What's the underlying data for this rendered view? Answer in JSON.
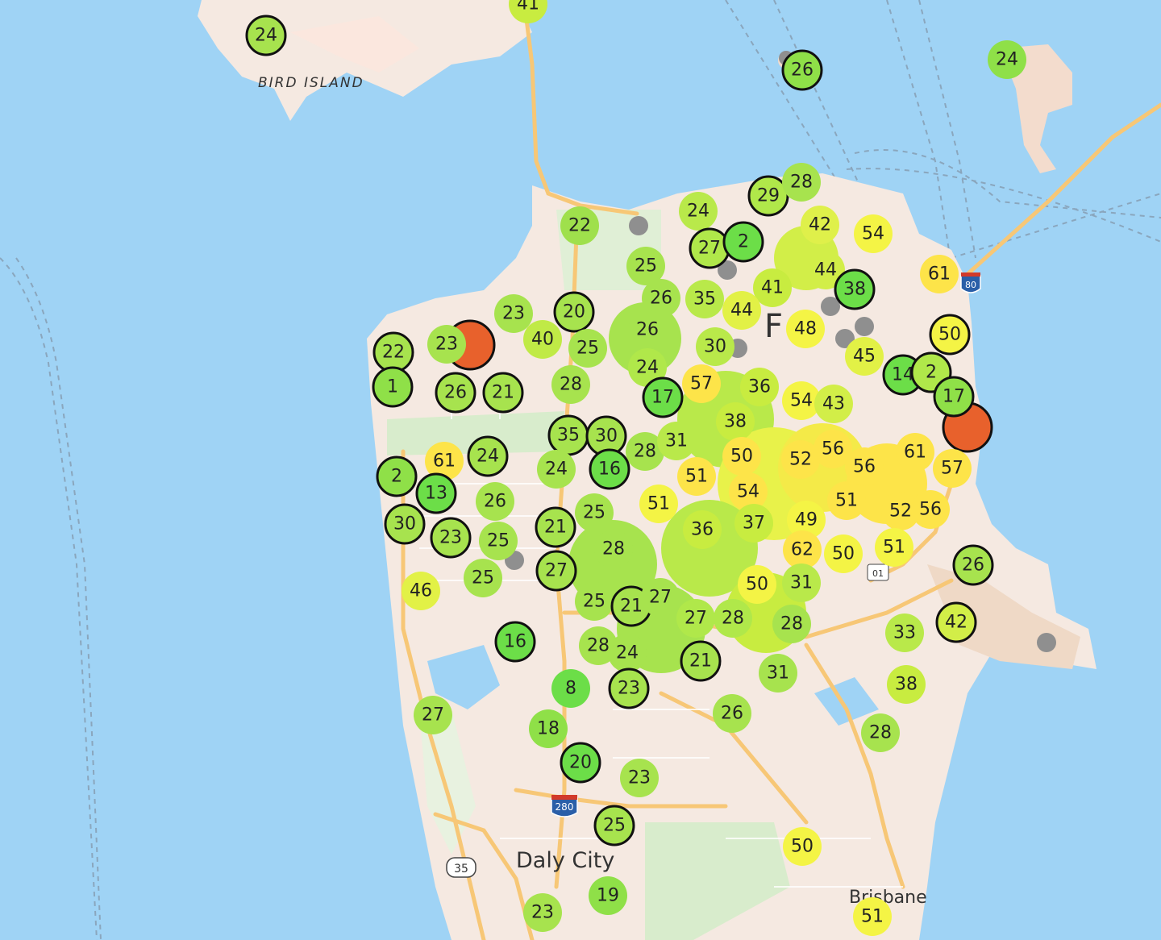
{
  "map": {
    "place_labels": {
      "bird_island": "BIRD ISLAND",
      "daly_city": "Daly City",
      "brisbane": "Brisbane",
      "sf_partial": "F"
    },
    "shields": {
      "i280": "280",
      "ca35": "35",
      "i80": "80",
      "i101": "01"
    },
    "colors": {
      "water": "#9fd3f5",
      "land": "#f5e9e1",
      "park": "#d8eccc",
      "road": "#f7c776",
      "gray_marker": "#8f8f8f",
      "ring": "#111111"
    }
  },
  "markers": [
    {
      "value": "41",
      "color": "#c8ec40",
      "ring": false
    },
    {
      "value": "24",
      "color": "#a7e34e",
      "ring": true
    },
    {
      "value": "26",
      "color": "#8fe048",
      "ring": true
    },
    {
      "value": "24",
      "color": "#8fe048",
      "ring": false
    },
    {
      "value": "29",
      "color": "#b0e84a",
      "ring": true
    },
    {
      "value": "28",
      "color": "#a7e34e",
      "ring": false
    },
    {
      "value": "22",
      "color": "#9fe04c",
      "ring": false
    },
    {
      "value": "24",
      "color": "#b9e94a",
      "ring": false
    },
    {
      "value": "42",
      "color": "#dff04a",
      "ring": false
    },
    {
      "value": "54",
      "color": "#f4f445",
      "ring": false
    },
    {
      "value": "27",
      "color": "#b0e84a",
      "ring": true
    },
    {
      "value": "2",
      "color": "#6cde48",
      "ring": true
    },
    {
      "value": "25",
      "color": "#a7e34e",
      "ring": false
    },
    {
      "value": "44",
      "color": "#d2ee48",
      "ring": false
    },
    {
      "value": "61",
      "color": "#fde449",
      "ring": false
    },
    {
      "value": "38",
      "color": "#6cde48",
      "ring": true
    },
    {
      "value": "41",
      "color": "#c8ec40",
      "ring": false
    },
    {
      "value": "26",
      "color": "#a7e34e",
      "ring": false
    },
    {
      "value": "35",
      "color": "#b9e94a",
      "ring": false
    },
    {
      "value": "44",
      "color": "#e2f146",
      "ring": false
    },
    {
      "value": "20",
      "color": "#a7e34e",
      "ring": true
    },
    {
      "value": "23",
      "color": "#a7e34e",
      "ring": false
    },
    {
      "value": "40",
      "color": "#c0ea46",
      "ring": false
    },
    {
      "value": "26",
      "color": "#a7e34e",
      "ring": false
    },
    {
      "value": "48",
      "color": "#f4f445",
      "ring": false
    },
    {
      "value": "50",
      "color": "#f4f445",
      "ring": true
    },
    {
      "value": "22",
      "color": "#a7e34e",
      "ring": true
    },
    {
      "value": "23",
      "color": "#a7e34e",
      "ring": false
    },
    {
      "value": "25",
      "color": "#a7e34e",
      "ring": false
    },
    {
      "value": "30",
      "color": "#b9e94a",
      "ring": false
    },
    {
      "value": "45",
      "color": "#e2f146",
      "ring": false
    },
    {
      "value": "1",
      "color": "#8fe048",
      "ring": true
    },
    {
      "value": "26",
      "color": "#a7e34e",
      "ring": true
    },
    {
      "value": "21",
      "color": "#a7e34e",
      "ring": true
    },
    {
      "value": "28",
      "color": "#a7e34e",
      "ring": false
    },
    {
      "value": "24",
      "color": "#b0e84a",
      "ring": false
    },
    {
      "value": "57",
      "color": "#fde449",
      "ring": false
    },
    {
      "value": "36",
      "color": "#c8ec40",
      "ring": false
    },
    {
      "value": "14",
      "color": "#6cde48",
      "ring": true
    },
    {
      "value": "2",
      "color": "#b0e84a",
      "ring": true
    },
    {
      "value": "17",
      "color": "#8fe048",
      "ring": true
    },
    {
      "value": "17",
      "color": "#6cde48",
      "ring": true
    },
    {
      "value": "54",
      "color": "#f4f445",
      "ring": false
    },
    {
      "value": "43",
      "color": "#d2ee48",
      "ring": false
    },
    {
      "value": "38",
      "color": "#c8ec40",
      "ring": false
    },
    {
      "value": "35",
      "color": "#a7e34e",
      "ring": true
    },
    {
      "value": "30",
      "color": "#a7e34e",
      "ring": true
    },
    {
      "value": "28",
      "color": "#a7e34e",
      "ring": false
    },
    {
      "value": "31",
      "color": "#b9e94a",
      "ring": false
    },
    {
      "value": "56",
      "color": "#fde449",
      "ring": false
    },
    {
      "value": "61",
      "color": "#fde449",
      "ring": false
    },
    {
      "value": "61",
      "color": "#fde449",
      "ring": false
    },
    {
      "value": "24",
      "color": "#a7e34e",
      "ring": true
    },
    {
      "value": "24",
      "color": "#a7e34e",
      "ring": false
    },
    {
      "value": "16",
      "color": "#6cde48",
      "ring": true
    },
    {
      "value": "50",
      "color": "#fde449",
      "ring": false
    },
    {
      "value": "52",
      "color": "#fde449",
      "ring": false
    },
    {
      "value": "56",
      "color": "#fde449",
      "ring": false
    },
    {
      "value": "57",
      "color": "#fde449",
      "ring": false
    },
    {
      "value": "2",
      "color": "#8fe048",
      "ring": true
    },
    {
      "value": "13",
      "color": "#6cde48",
      "ring": true
    },
    {
      "value": "26",
      "color": "#a7e34e",
      "ring": false
    },
    {
      "value": "51",
      "color": "#fde449",
      "ring": false
    },
    {
      "value": "54",
      "color": "#fde449",
      "ring": false
    },
    {
      "value": "51",
      "color": "#f4f445",
      "ring": false
    },
    {
      "value": "25",
      "color": "#a7e34e",
      "ring": false
    },
    {
      "value": "51",
      "color": "#fde449",
      "ring": false
    },
    {
      "value": "52",
      "color": "#fde449",
      "ring": false
    },
    {
      "value": "56",
      "color": "#fde449",
      "ring": false
    },
    {
      "value": "30",
      "color": "#a7e34e",
      "ring": true
    },
    {
      "value": "21",
      "color": "#a7e34e",
      "ring": true
    },
    {
      "value": "36",
      "color": "#c8ec40",
      "ring": false
    },
    {
      "value": "37",
      "color": "#c8ec40",
      "ring": false
    },
    {
      "value": "49",
      "color": "#f4f445",
      "ring": false
    },
    {
      "value": "23",
      "color": "#a7e34e",
      "ring": true
    },
    {
      "value": "25",
      "color": "#a7e34e",
      "ring": false
    },
    {
      "value": "28",
      "color": "#a7e34e",
      "ring": false
    },
    {
      "value": "62",
      "color": "#fde449",
      "ring": false
    },
    {
      "value": "50",
      "color": "#f4f445",
      "ring": false
    },
    {
      "value": "51",
      "color": "#f4f445",
      "ring": false
    },
    {
      "value": "26",
      "color": "#a7e34e",
      "ring": true
    },
    {
      "value": "27",
      "color": "#a7e34e",
      "ring": true
    },
    {
      "value": "25",
      "color": "#a7e34e",
      "ring": false
    },
    {
      "value": "46",
      "color": "#e2f146",
      "ring": false
    },
    {
      "value": "50",
      "color": "#f4f445",
      "ring": false
    },
    {
      "value": "31",
      "color": "#b9e94a",
      "ring": false
    },
    {
      "value": "25",
      "color": "#a7e34e",
      "ring": false
    },
    {
      "value": "21",
      "color": "#a7e34e",
      "ring": true
    },
    {
      "value": "27",
      "color": "#a7e34e",
      "ring": false
    },
    {
      "value": "42",
      "color": "#d2ee48",
      "ring": true
    },
    {
      "value": "27",
      "color": "#b0e84a",
      "ring": false
    },
    {
      "value": "28",
      "color": "#b0e84a",
      "ring": false
    },
    {
      "value": "28",
      "color": "#a7e34e",
      "ring": false
    },
    {
      "value": "33",
      "color": "#b9e94a",
      "ring": false
    },
    {
      "value": "16",
      "color": "#6cde48",
      "ring": true
    },
    {
      "value": "28",
      "color": "#a7e34e",
      "ring": false
    },
    {
      "value": "24",
      "color": "#a7e34e",
      "ring": false
    },
    {
      "value": "21",
      "color": "#a7e34e",
      "ring": true
    },
    {
      "value": "31",
      "color": "#a7e34e",
      "ring": false
    },
    {
      "value": "38",
      "color": "#c8ec40",
      "ring": false
    },
    {
      "value": "8",
      "color": "#6cde48",
      "ring": false
    },
    {
      "value": "23",
      "color": "#a7e34e",
      "ring": true
    },
    {
      "value": "27",
      "color": "#a7e34e",
      "ring": false
    },
    {
      "value": "26",
      "color": "#a7e34e",
      "ring": false
    },
    {
      "value": "28",
      "color": "#a7e34e",
      "ring": false
    },
    {
      "value": "18",
      "color": "#8fe048",
      "ring": false
    },
    {
      "value": "20",
      "color": "#6cde48",
      "ring": true
    },
    {
      "value": "23",
      "color": "#a7e34e",
      "ring": false
    },
    {
      "value": "25",
      "color": "#a7e34e",
      "ring": true
    },
    {
      "value": "50",
      "color": "#f4f445",
      "ring": false
    },
    {
      "value": "19",
      "color": "#8fe048",
      "ring": false
    },
    {
      "value": "23",
      "color": "#a7e34e",
      "ring": false
    },
    {
      "value": "51",
      "color": "#f4f445",
      "ring": false
    }
  ]
}
